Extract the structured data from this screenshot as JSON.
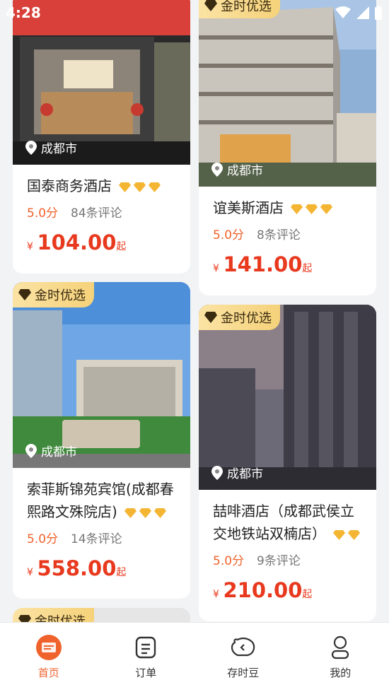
{
  "status_bar": {
    "time": "4:28"
  },
  "colors": {
    "accent": "#f0622b",
    "price": "#e8391e",
    "badge_bg": "#f5d27a"
  },
  "cards": [
    {
      "badge": "",
      "location": "成都市",
      "name": "国泰商务酒店",
      "diamonds": 3,
      "score": "5.0分",
      "reviews": "84条评论",
      "currency": "¥",
      "price": "104.00",
      "price_suffix": "起"
    },
    {
      "badge": "金时优选",
      "location": "成都市",
      "name": "谊美斯酒店",
      "diamonds": 3,
      "score": "5.0分",
      "reviews": "8条评论",
      "currency": "¥",
      "price": "141.00",
      "price_suffix": "起"
    },
    {
      "badge": "金时优选",
      "location": "成都市",
      "name": "索菲斯锦苑宾馆(成都春熙路文殊院店)",
      "diamonds": 3,
      "score": "5.0分",
      "reviews": "14条评论",
      "currency": "¥",
      "price": "558.00",
      "price_suffix": "起"
    },
    {
      "badge": "金时优选",
      "location": "成都市",
      "name": "喆啡酒店（成都武侯立交地铁站双楠店）",
      "diamonds": 2,
      "score": "5.0分",
      "reviews": "9条评论",
      "currency": "¥",
      "price": "210.00",
      "price_suffix": "起"
    },
    {
      "badge": "金时优选"
    }
  ],
  "tabbar": [
    {
      "label": "首页",
      "icon": "home-logo-icon",
      "active": true
    },
    {
      "label": "订单",
      "icon": "order-list-icon",
      "active": false
    },
    {
      "label": "存时豆",
      "icon": "piggy-bank-icon",
      "active": false
    },
    {
      "label": "我的",
      "icon": "person-icon",
      "active": false
    }
  ]
}
